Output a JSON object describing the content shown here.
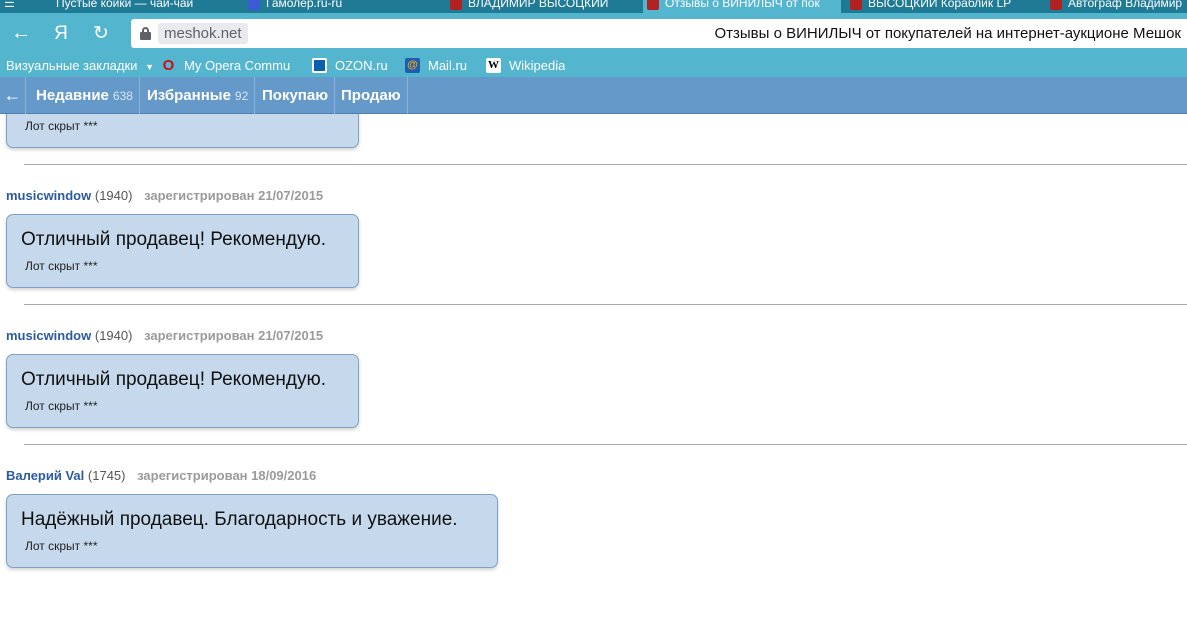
{
  "browser": {
    "tabs": [
      {
        "label": "Пустые койки — чай-чай"
      },
      {
        "label": "Гамолер.ru-ru"
      },
      {
        "label": "ВЛАДИМИР ВЫСОЦКИЙ"
      },
      {
        "label": "Отзывы о ВИНИЛЫЧ от пок"
      },
      {
        "label": "ВЫСОЦКИЙ Кораблик LP"
      },
      {
        "label": "Автограф Владимир"
      }
    ],
    "address": {
      "domain": "meshok.net",
      "page_title": "Отзывы о ВИНИЛЫЧ от покупателей на интернет-аукционе Мешок"
    },
    "nav_buttons": {
      "back": "←",
      "yandex": "Я",
      "reload": "↻"
    },
    "bookmarks": [
      {
        "label": "Визуальные закладки",
        "icon": "dropdown-icon"
      },
      {
        "label": "My Opera Commu",
        "icon": "opera-icon"
      },
      {
        "label": "OZON.ru",
        "icon": "ozon-icon"
      },
      {
        "label": "Mail.ru",
        "icon": "mailru-icon"
      },
      {
        "label": "Wikipedia",
        "icon": "wikipedia-icon"
      }
    ]
  },
  "site_nav": {
    "back_arrow": "←",
    "items": [
      {
        "label": "Недавние",
        "count": "638"
      },
      {
        "label": "Избранные",
        "count": "92"
      },
      {
        "label": "Покупаю",
        "count": ""
      },
      {
        "label": "Продаю",
        "count": ""
      }
    ]
  },
  "reviews": [
    {
      "user": "",
      "rating": "",
      "registered": "",
      "message": "",
      "lot": "Лот скрыт ***"
    },
    {
      "user": "musicwindow",
      "rating": "(1940)",
      "registered": "зарегистрирован 21/07/2015",
      "message": "Отличный продавец! Рекомендую.",
      "lot": "Лот скрыт ***"
    },
    {
      "user": "musicwindow",
      "rating": "(1940)",
      "registered": "зарегистрирован 21/07/2015",
      "message": "Отличный продавец! Рекомендую.",
      "lot": "Лот скрыт ***"
    },
    {
      "user": "Валерий Val",
      "rating": "(1745)",
      "registered": "зарегистрирован 18/09/2016",
      "message": "Надёжный продавец. Благодарность и уважение.",
      "lot": "Лот скрыт ***"
    }
  ],
  "colors": {
    "tab_strip": "#1f7a96",
    "toolbar": "#54b5cf",
    "site_nav": "#6499c9",
    "bubble": "#c6d9ec",
    "username": "#2c5aa0"
  }
}
